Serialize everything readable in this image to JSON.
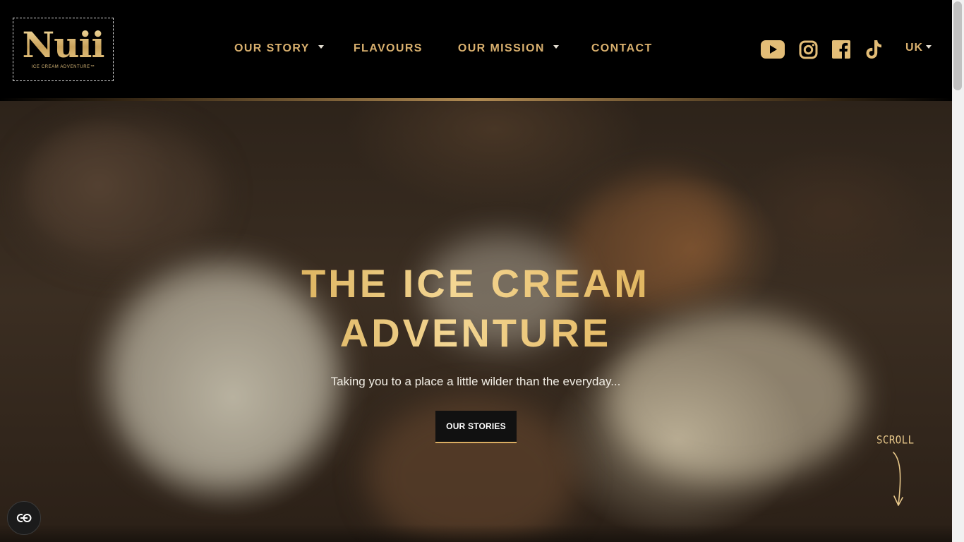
{
  "brand": {
    "logo_text": "Nuii",
    "logo_tagline": "ICE CREAM ADVENTURE™"
  },
  "nav": {
    "items": [
      {
        "label": "OUR STORY",
        "dropdown": true
      },
      {
        "label": "FLAVOURS",
        "dropdown": false
      },
      {
        "label": "OUR MISSION",
        "dropdown": true
      },
      {
        "label": "CONTACT",
        "dropdown": false
      }
    ]
  },
  "socials": {
    "items": [
      {
        "name": "youtube-icon"
      },
      {
        "name": "instagram-icon"
      },
      {
        "name": "facebook-icon"
      },
      {
        "name": "tiktok-icon"
      }
    ]
  },
  "language": {
    "current": "UK"
  },
  "hero": {
    "title_line1": "THE ICE CREAM",
    "title_line2": "ADVENTURE",
    "subtitle": "Taking you to a place a little wilder than the everyday...",
    "cta_label": "OUR STORIES",
    "scroll_label": "SCROLL"
  },
  "colors": {
    "accent_gold": "#d9b06e",
    "header_bg": "#000000",
    "cta_bg": "#111111"
  }
}
